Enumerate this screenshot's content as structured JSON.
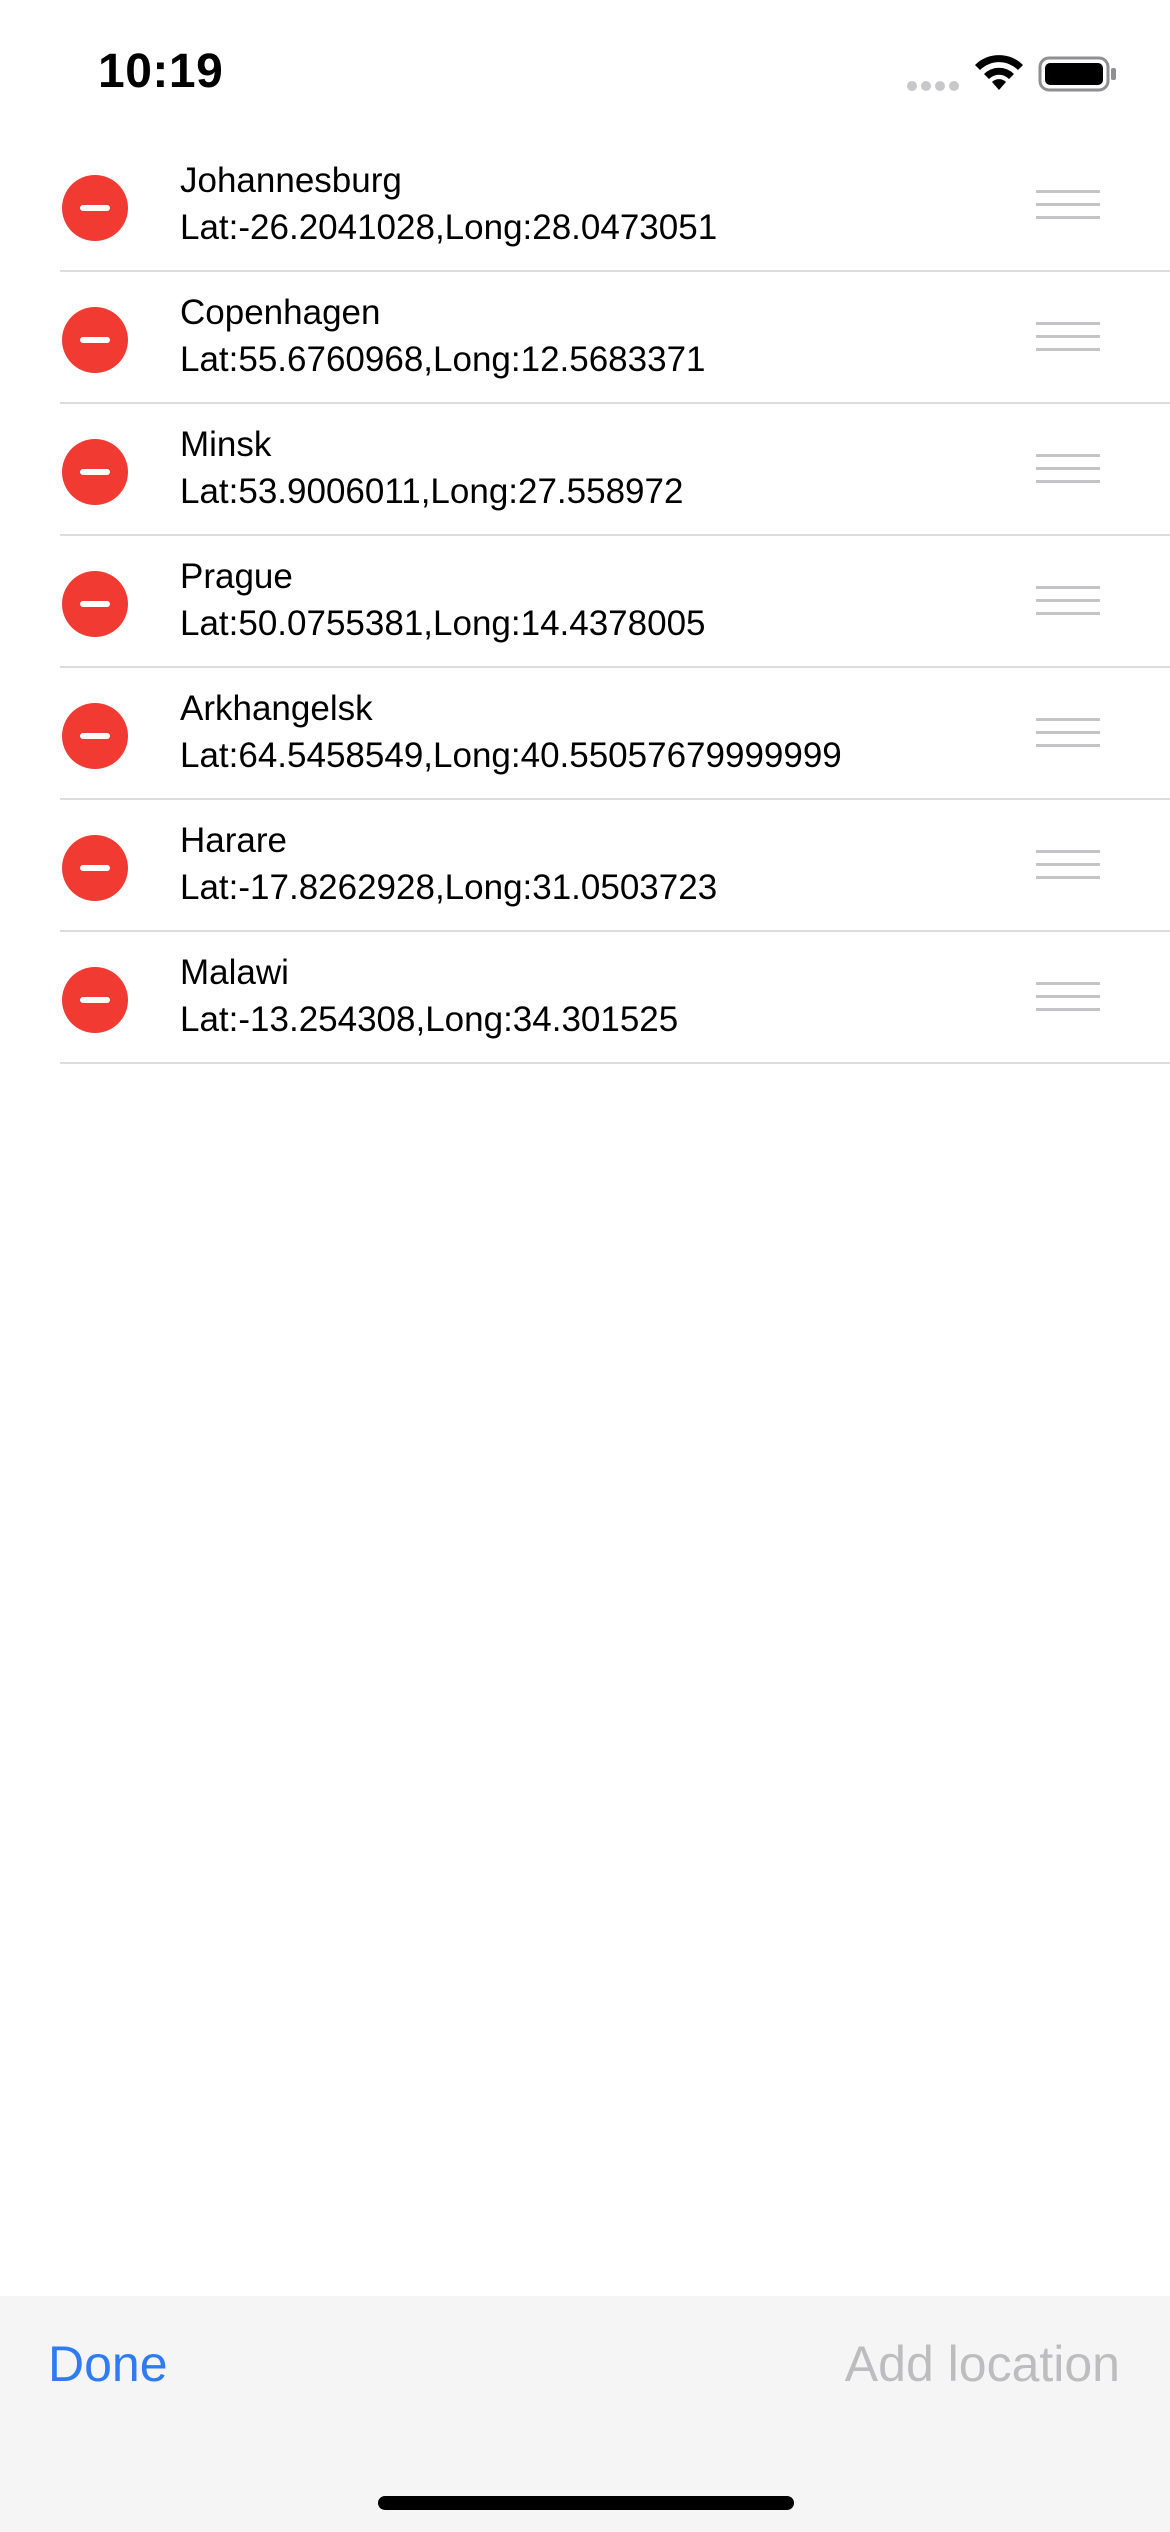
{
  "status_bar": {
    "time": "10:19",
    "icons": [
      "cellular-signal-icon",
      "wifi-icon",
      "battery-icon"
    ]
  },
  "locations": [
    {
      "title": "Johannesburg",
      "coords": "Lat:-26.2041028,Long:28.0473051"
    },
    {
      "title": "Copenhagen",
      "coords": "Lat:55.6760968,Long:12.5683371"
    },
    {
      "title": "Minsk",
      "coords": "Lat:53.9006011,Long:27.558972"
    },
    {
      "title": "Prague",
      "coords": "Lat:50.0755381,Long:14.4378005"
    },
    {
      "title": "Arkhangelsk",
      "coords": "Lat:64.5458549,Long:40.55057679999999"
    },
    {
      "title": "Harare",
      "coords": "Lat:-17.8262928,Long:31.0503723"
    },
    {
      "title": "Malawi",
      "coords": "Lat:-13.254308,Long:34.301525"
    }
  ],
  "toolbar": {
    "done_label": "Done",
    "add_label": "Add location"
  },
  "colors": {
    "accent": "#2f7bf5",
    "delete": "#f03a32",
    "disabled": "#bdbdc1",
    "toolbar_bg": "#f5f5f5"
  }
}
